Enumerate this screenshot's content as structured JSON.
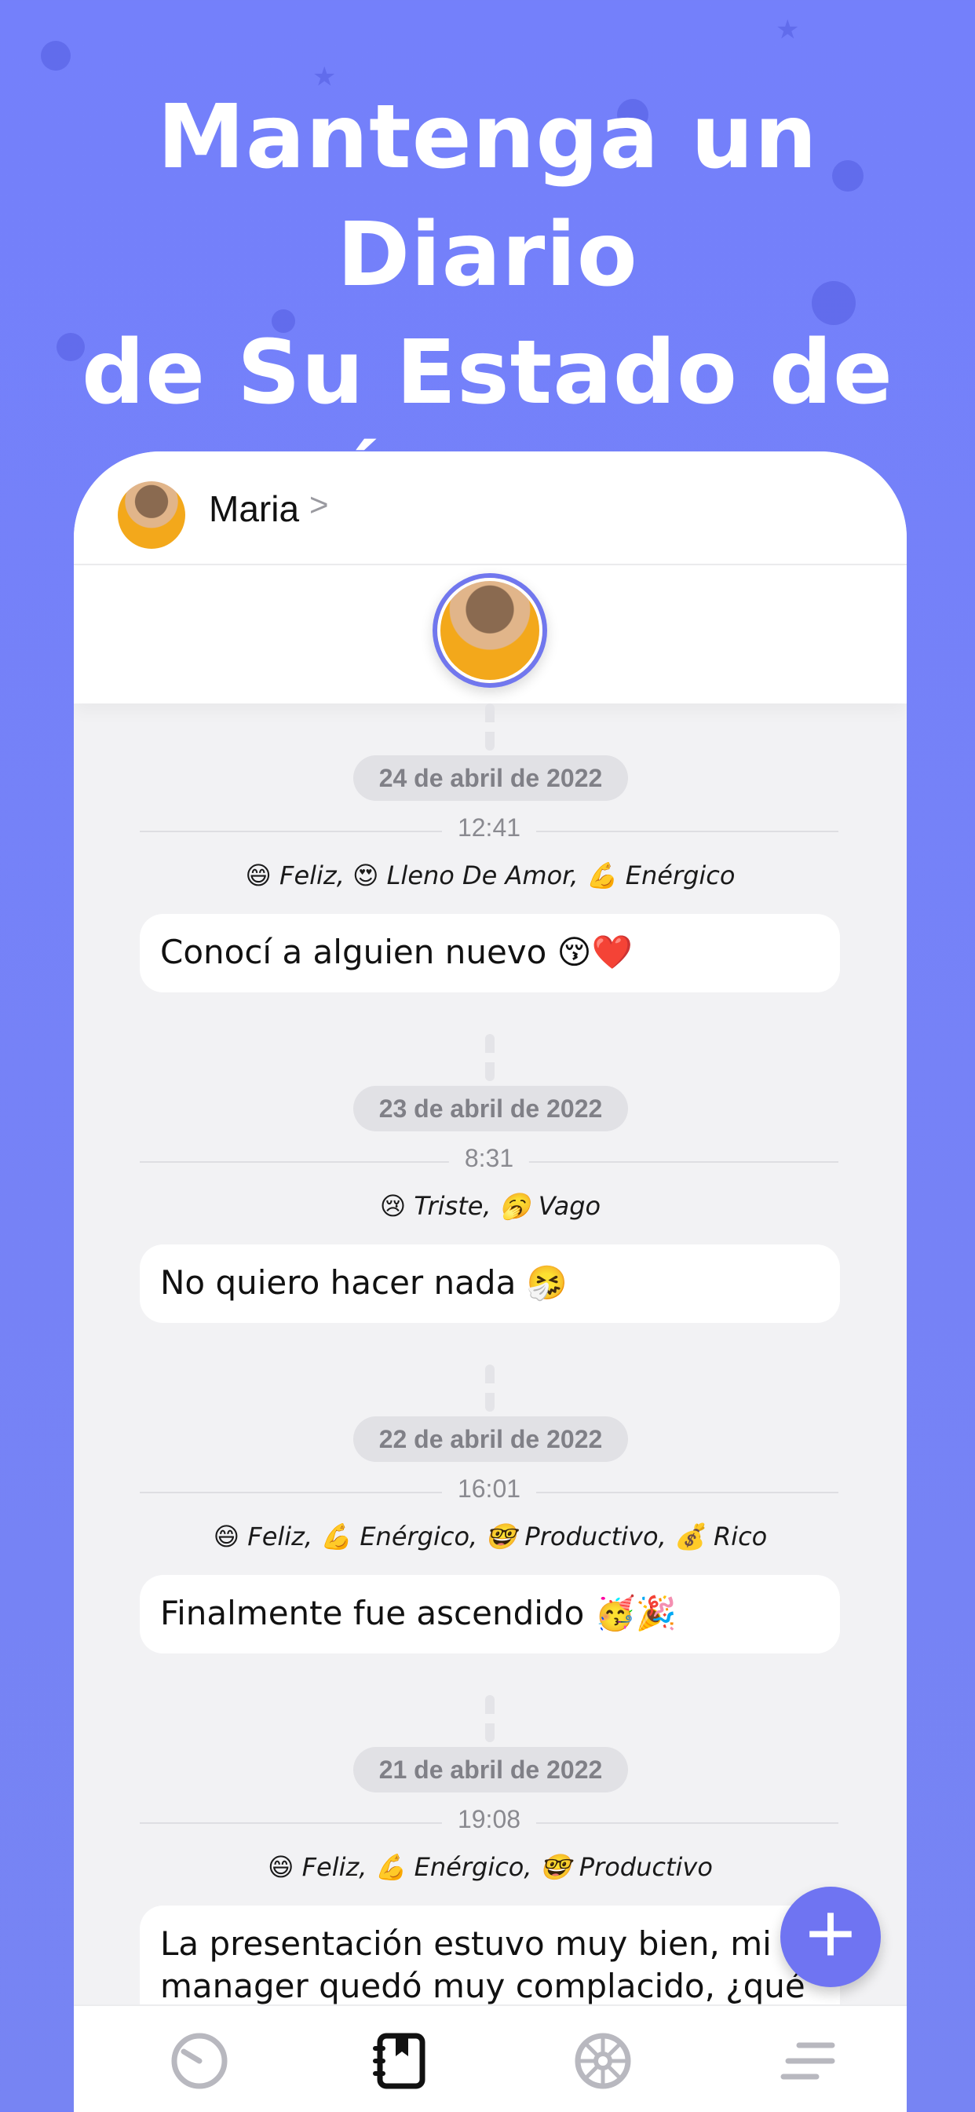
{
  "headline": {
    "line1": "Mantenga un Diario",
    "line2": "de Su Estado de",
    "line3": "Ánimo"
  },
  "profile": {
    "name": "Maria",
    "chevron": ">"
  },
  "entries": [
    {
      "date": "24 de abril de 2022",
      "time": "12:41",
      "moods": "😄 Feliz,  😍 Lleno De Amor,  💪 Enérgico",
      "text": "Conocí a alguien nuevo 😚❤️"
    },
    {
      "date": "23 de abril de 2022",
      "time": "8:31",
      "moods": "😢 Triste,  🥱 Vago",
      "text": "No quiero hacer nada 🤧"
    },
    {
      "date": "22 de abril de 2022",
      "time": "16:01",
      "moods": "😄 Feliz,  💪 Enérgico,  🤓 Productivo,  💰 Rico",
      "text": "Finalmente fue ascendido 🥳🎉"
    },
    {
      "date": "21 de abril de 2022",
      "time": "19:08",
      "moods": "😄 Feliz,  💪 Enérgico,  🤓 Productivo",
      "text": "La presentación estuvo muy bien, mi manager quedó muy complacido, ¿qué más"
    }
  ],
  "fab": {
    "icon": "plus-icon",
    "label": "+"
  },
  "tabbar": {
    "items": [
      {
        "icon": "clock-icon",
        "active": false
      },
      {
        "icon": "journal-icon",
        "active": true
      },
      {
        "icon": "wheel-icon",
        "active": false
      },
      {
        "icon": "menu-icon",
        "active": false
      }
    ]
  },
  "colors": {
    "background": "#7480fb",
    "accent": "#6f74f2",
    "card": "#ffffff",
    "panel": "#f2f2f4"
  }
}
